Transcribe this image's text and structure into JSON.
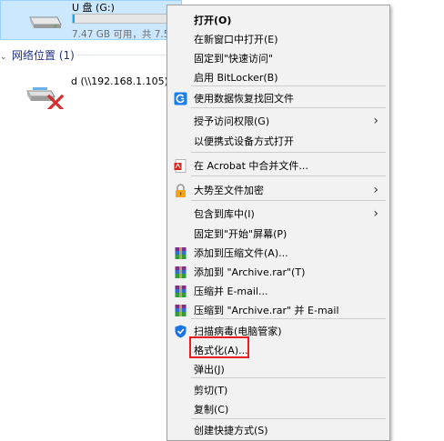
{
  "explorer": {
    "drive": {
      "name": "U 盘 (G:)",
      "space": "7.47 GB 可用，共 7.5",
      "used_fraction": 0.02
    },
    "network_group": {
      "label": "网络位置 (1)"
    },
    "network_drive": {
      "name": "d (\\\\192.168.1.105) ("
    }
  },
  "menu": {
    "items": [
      {
        "label": "打开(O)",
        "bold": true
      },
      {
        "label": "在新窗口中打开(E)"
      },
      {
        "label": "固定到\"快速访问\""
      },
      {
        "label": "启用 BitLocker(B)"
      },
      {
        "label": "使用数据恢复找回文件",
        "icon": "recovery-icon"
      },
      {
        "label": "授予访问权限(G)",
        "submenu": true
      },
      {
        "label": "以便携式设备方式打开"
      },
      {
        "label": "在 Acrobat 中合并文件...",
        "icon": "acrobat-icon"
      },
      {
        "label": "大势至文件加密",
        "icon": "lock-icon",
        "submenu": true
      },
      {
        "label": "包含到库中(I)",
        "submenu": true
      },
      {
        "label": "固定到\"开始\"屏幕(P)"
      },
      {
        "label": "添加到压缩文件(A)...",
        "icon": "winrar-icon"
      },
      {
        "label": "添加到 \"Archive.rar\"(T)",
        "icon": "winrar-icon"
      },
      {
        "label": "压缩并 E-mail...",
        "icon": "winrar-icon"
      },
      {
        "label": "压缩到 \"Archive.rar\" 并 E-mail",
        "icon": "winrar-icon"
      },
      {
        "label": "扫描病毒(电脑管家)",
        "icon": "shield-icon"
      },
      {
        "label": "格式化(A)...",
        "highlighted": true
      },
      {
        "label": "弹出(J)"
      },
      {
        "label": "剪切(T)"
      },
      {
        "label": "复制(C)"
      },
      {
        "label": "创建快捷方式(S)"
      }
    ],
    "submenu_arrow": "›",
    "highlight_color": "#e51e25"
  }
}
